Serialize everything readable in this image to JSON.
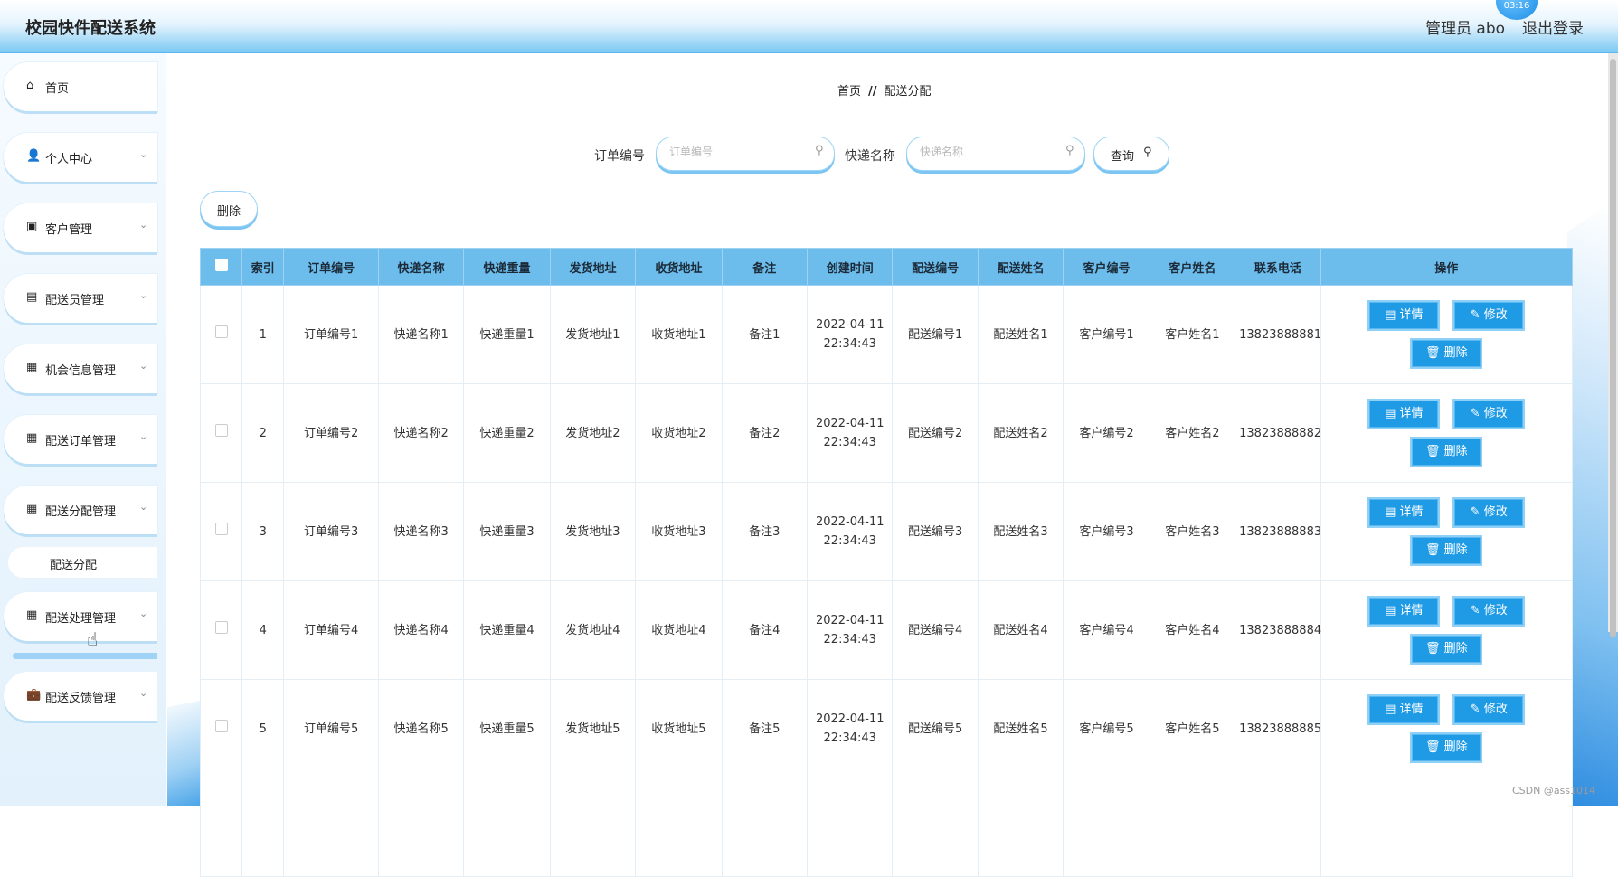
{
  "header": {
    "app_title": "校园快件配送系统",
    "user_label": "管理员 abo",
    "logout_label": "退出登录",
    "bubble_text": "03:16"
  },
  "sidebar": {
    "items": [
      {
        "label": "首页",
        "icon": "home-icon",
        "glyph": "⌂"
      },
      {
        "label": "个人中心",
        "icon": "user-icon",
        "glyph": "👤"
      },
      {
        "label": "客户管理",
        "icon": "chart-icon",
        "glyph": "▣"
      },
      {
        "label": "配送员管理",
        "icon": "clipboard-icon",
        "glyph": "▤"
      },
      {
        "label": "机会信息管理",
        "icon": "grid-icon",
        "glyph": "▦"
      },
      {
        "label": "配送订单管理",
        "icon": "grid-icon",
        "glyph": "▦"
      },
      {
        "label": "配送分配管理",
        "icon": "grid-icon",
        "glyph": "▦"
      },
      {
        "label": "配送处理管理",
        "icon": "grid-icon",
        "glyph": "▦"
      },
      {
        "label": "配送反馈管理",
        "icon": "briefcase-icon",
        "glyph": "💼"
      }
    ],
    "submenu_label": "配送分配"
  },
  "breadcrumb": {
    "home": "首页",
    "separator": "//",
    "current": "配送分配"
  },
  "search": {
    "order_label": "订单编号",
    "order_placeholder": "订单编号",
    "express_label": "快递名称",
    "express_placeholder": "快递名称",
    "query_label": "查询"
  },
  "toolbar": {
    "delete_label": "删除"
  },
  "table": {
    "columns": [
      "索引",
      "订单编号",
      "快递名称",
      "快递重量",
      "发货地址",
      "收货地址",
      "备注",
      "创建时间",
      "配送编号",
      "配送姓名",
      "客户编号",
      "客户姓名",
      "联系电话",
      "操作"
    ],
    "rows": [
      {
        "index": "1",
        "order": "订单编号1",
        "express": "快递名称1",
        "weight": "快递重量1",
        "from": "发货地址1",
        "to": "收货地址1",
        "note": "备注1",
        "created": "2022-04-11 22:34:43",
        "delivery_no": "配送编号1",
        "delivery_name": "配送姓名1",
        "customer_no": "客户编号1",
        "customer_name": "客户姓名1",
        "phone": "13823888881"
      },
      {
        "index": "2",
        "order": "订单编号2",
        "express": "快递名称2",
        "weight": "快递重量2",
        "from": "发货地址2",
        "to": "收货地址2",
        "note": "备注2",
        "created": "2022-04-11 22:34:43",
        "delivery_no": "配送编号2",
        "delivery_name": "配送姓名2",
        "customer_no": "客户编号2",
        "customer_name": "客户姓名2",
        "phone": "13823888882"
      },
      {
        "index": "3",
        "order": "订单编号3",
        "express": "快递名称3",
        "weight": "快递重量3",
        "from": "发货地址3",
        "to": "收货地址3",
        "note": "备注3",
        "created": "2022-04-11 22:34:43",
        "delivery_no": "配送编号3",
        "delivery_name": "配送姓名3",
        "customer_no": "客户编号3",
        "customer_name": "客户姓名3",
        "phone": "13823888883"
      },
      {
        "index": "4",
        "order": "订单编号4",
        "express": "快递名称4",
        "weight": "快递重量4",
        "from": "发货地址4",
        "to": "收货地址4",
        "note": "备注4",
        "created": "2022-04-11 22:34:43",
        "delivery_no": "配送编号4",
        "delivery_name": "配送姓名4",
        "customer_no": "客户编号4",
        "customer_name": "客户姓名4",
        "phone": "13823888884"
      },
      {
        "index": "5",
        "order": "订单编号5",
        "express": "快递名称5",
        "weight": "快递重量5",
        "from": "发货地址5",
        "to": "收货地址5",
        "note": "备注5",
        "created": "2022-04-11 22:34:43",
        "delivery_no": "配送编号5",
        "delivery_name": "配送姓名5",
        "customer_no": "客户编号5",
        "customer_name": "客户姓名5",
        "phone": "13823888885"
      },
      {
        "index": "",
        "order": "",
        "express": "",
        "weight": "",
        "from": "",
        "to": "",
        "note": "",
        "created": "",
        "delivery_no": "",
        "delivery_name": "",
        "customer_no": "",
        "customer_name": "",
        "phone": ""
      }
    ],
    "actions": {
      "detail": "详情",
      "edit": "修改",
      "delete": "删除"
    }
  },
  "watermark": "CSDN @ass1014",
  "colors": {
    "accent": "#1f9be6",
    "header_bg": "#6cbcec",
    "topbar": "#7cc9f3"
  }
}
